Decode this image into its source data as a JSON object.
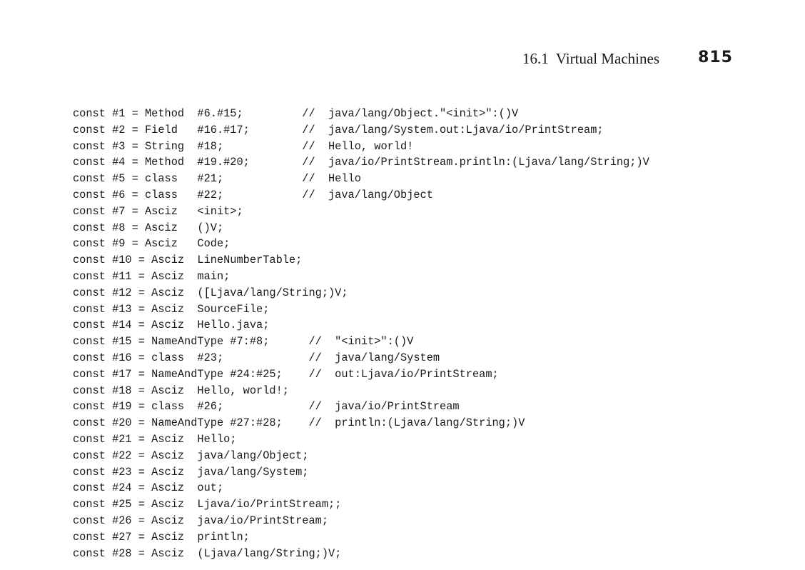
{
  "header": {
    "section_title": "16.1  Virtual Machines",
    "page_number": "815"
  },
  "code_lines": [
    "const #1 = Method  #6.#15;         //  java/lang/Object.\"<init>\":()V",
    "const #2 = Field   #16.#17;        //  java/lang/System.out:Ljava/io/PrintStream;",
    "const #3 = String  #18;            //  Hello, world!",
    "const #4 = Method  #19.#20;        //  java/io/PrintStream.println:(Ljava/lang/String;)V",
    "const #5 = class   #21;            //  Hello",
    "const #6 = class   #22;            //  java/lang/Object",
    "const #7 = Asciz   <init>;",
    "const #8 = Asciz   ()V;",
    "const #9 = Asciz   Code;",
    "const #10 = Asciz  LineNumberTable;",
    "const #11 = Asciz  main;",
    "const #12 = Asciz  ([Ljava/lang/String;)V;",
    "const #13 = Asciz  SourceFile;",
    "const #14 = Asciz  Hello.java;",
    "const #15 = NameAndType #7:#8;      //  \"<init>\":()V",
    "const #16 = class  #23;             //  java/lang/System",
    "const #17 = NameAndType #24:#25;    //  out:Ljava/io/PrintStream;",
    "const #18 = Asciz  Hello, world!;",
    "const #19 = class  #26;             //  java/io/PrintStream",
    "const #20 = NameAndType #27:#28;    //  println:(Ljava/lang/String;)V",
    "const #21 = Asciz  Hello;",
    "const #22 = Asciz  java/lang/Object;",
    "const #23 = Asciz  java/lang/System;",
    "const #24 = Asciz  out;",
    "const #25 = Asciz  Ljava/io/PrintStream;;",
    "const #26 = Asciz  java/io/PrintStream;",
    "const #27 = Asciz  println;",
    "const #28 = Asciz  (Ljava/lang/String;)V;"
  ]
}
